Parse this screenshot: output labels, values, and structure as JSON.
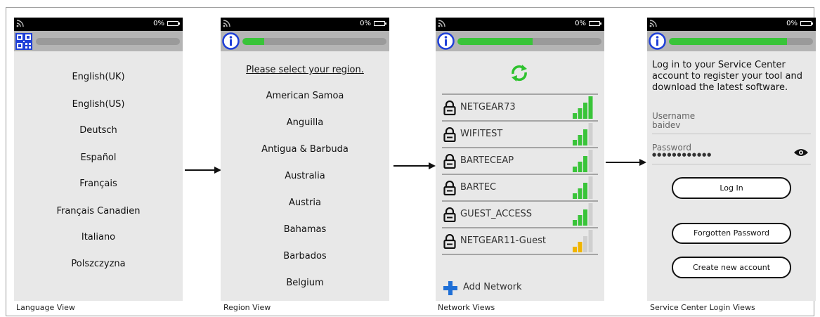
{
  "status_bar": {
    "battery_text": "0%"
  },
  "language_view": {
    "caption": "Language View",
    "languages": [
      "English(UK)",
      "English(US)",
      "Deutsch",
      "Español",
      "Français",
      "Français Canadien",
      "Italiano",
      "Polszczyzna"
    ]
  },
  "region_view": {
    "caption": "Region View",
    "progress": 0.15,
    "prompt": "Please select your region.",
    "regions": [
      "American Samoa",
      "Anguilla",
      "Antigua & Barbuda",
      "Australia",
      "Austria",
      "Bahamas",
      "Barbados",
      "Belgium"
    ]
  },
  "network_view": {
    "caption": "Network Views",
    "progress": 0.52,
    "networks": [
      {
        "name": "NETGEAR73",
        "signal": 4,
        "color": "#39c439"
      },
      {
        "name": "WIFITEST",
        "signal": 3,
        "color": "#39c439"
      },
      {
        "name": "BARTECEAP",
        "signal": 3,
        "color": "#39c439"
      },
      {
        "name": "BARTEC",
        "signal": 3,
        "color": "#39c439"
      },
      {
        "name": "GUEST_ACCESS",
        "signal": 3,
        "color": "#39c439"
      },
      {
        "name": "NETGEAR11-Guest",
        "signal": 2,
        "color": "#f0b400"
      }
    ],
    "add_network_label": "Add Network"
  },
  "login_view": {
    "caption": "Service Center Login Views",
    "progress": 0.82,
    "intro_lines": [
      "Log in to your Service Center",
      "account to register your tool and",
      "download the latest software."
    ],
    "username_label": "Username",
    "username_value": "baidev",
    "password_label": "Password",
    "password_value": "●●●●●●●●●●●●",
    "login_button": "Log In",
    "forgot_button": "Forgotten Password",
    "create_button": "Create new account"
  },
  "colors": {
    "accent_blue": "#1e3fd8",
    "progress_green": "#39c439",
    "signal_yellow": "#f0b400",
    "add_blue": "#1f6fd6"
  }
}
